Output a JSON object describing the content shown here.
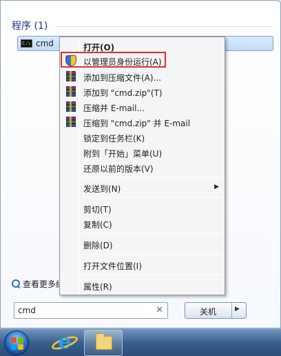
{
  "start_menu": {
    "section_header": "程序 (1)",
    "program": {
      "label": "cmd",
      "icon": "cmd-icon",
      "icon_text": "C:\\"
    },
    "search_more_label": "查看更多结",
    "search_box": {
      "value": "cmd",
      "clear_icon": "✕"
    },
    "shutdown": {
      "label": "关机",
      "arrow": "▶"
    }
  },
  "context_menu": {
    "items": [
      {
        "label": "打开(O)",
        "icon": "none",
        "bold": true
      },
      {
        "label": "以管理员身份运行(A)",
        "icon": "uac-shield-icon"
      },
      {
        "label": "添加到压缩文件(A)...",
        "icon": "winrar-icon"
      },
      {
        "label": "添加到 \"cmd.zip\"(T)",
        "icon": "winrar-icon"
      },
      {
        "label": "压缩并 E-mail...",
        "icon": "winrar-icon"
      },
      {
        "label": "压缩到 \"cmd.zip\" 并 E-mail",
        "icon": "winrar-icon"
      },
      {
        "label": "锁定到任务栏(K)",
        "icon": "none"
      },
      {
        "label": "附到「开始」菜单(U)",
        "icon": "none"
      },
      {
        "label": "还原以前的版本(V)",
        "icon": "none"
      },
      {
        "label": "发送到(N)",
        "icon": "none",
        "submenu": true,
        "arrow": "▶"
      },
      {
        "label": "剪切(T)",
        "icon": "none"
      },
      {
        "label": "复制(C)",
        "icon": "none"
      },
      {
        "label": "删除(D)",
        "icon": "none"
      },
      {
        "label": "打开文件位置(I)",
        "icon": "none"
      },
      {
        "label": "属性(R)",
        "icon": "none"
      }
    ],
    "highlighted_item": "以管理员身份运行(A)",
    "highlight_color": "#e52c2c"
  },
  "taskbar": {
    "items": [
      "start-orb-icon",
      "internet-explorer-icon",
      "windows-explorer-icon"
    ],
    "ie_glyph": "e"
  },
  "colors": {
    "header_text": "#1e3287",
    "selection": "#c1dcfc",
    "taskbar": "#3a5f8c"
  }
}
